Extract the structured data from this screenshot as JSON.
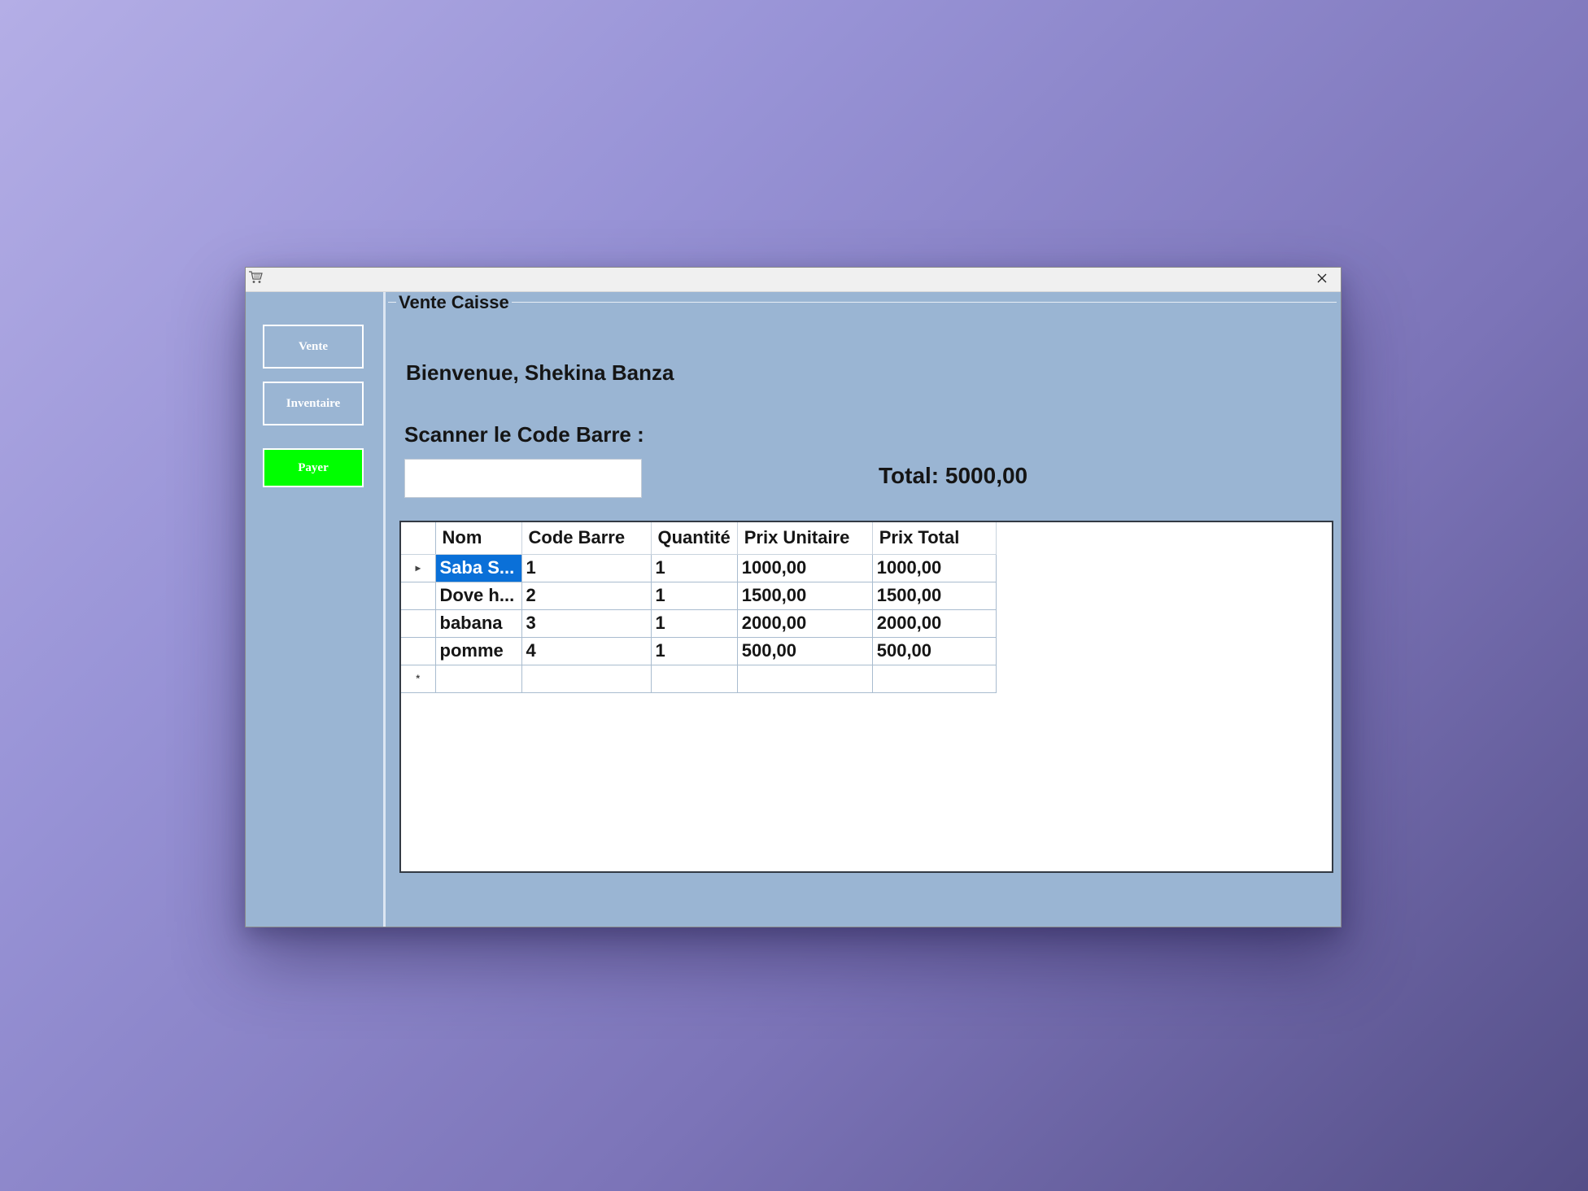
{
  "window": {
    "close_glyph": "✕"
  },
  "sidebar": {
    "vente_label": "Vente",
    "inventaire_label": "Inventaire",
    "payer_label": "Payer"
  },
  "main": {
    "group_title": "Vente Caisse",
    "welcome": "Bienvenue, Shekina Banza",
    "scan_label": "Scanner le Code Barre :",
    "scan_value": "",
    "total": "Total: 5000,00"
  },
  "grid": {
    "columns": [
      "Nom",
      "Code Barre",
      "Quantité",
      "Prix Unitaire",
      "Prix Total"
    ],
    "rows": [
      {
        "nom": "Saba S...",
        "code": "1",
        "qty": "1",
        "pu": "1000,00",
        "pt": "1000,00"
      },
      {
        "nom": "Dove h...",
        "code": "2",
        "qty": "1",
        "pu": "1500,00",
        "pt": "1500,00"
      },
      {
        "nom": "babana",
        "code": "3",
        "qty": "1",
        "pu": "2000,00",
        "pt": "2000,00"
      },
      {
        "nom": "pomme",
        "code": "4",
        "qty": "1",
        "pu": "500,00",
        "pt": "500,00"
      }
    ],
    "current_marker": "▸",
    "new_row_marker": "*"
  },
  "colors": {
    "payer_button": "#00ff00",
    "form_background": "#9ab5d3",
    "selection": "#0a70d8"
  },
  "icons": {
    "app": "shopping-cart-icon",
    "close": "close-icon"
  }
}
